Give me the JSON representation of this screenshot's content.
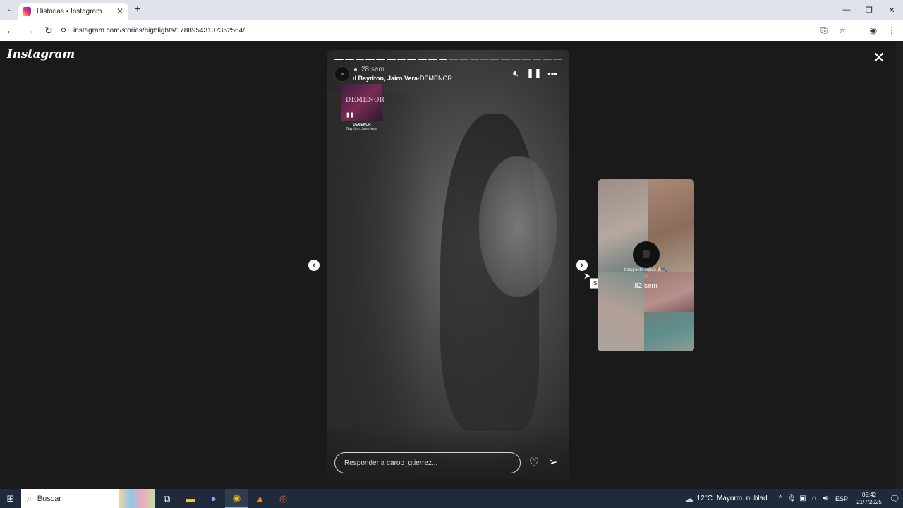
{
  "browser": {
    "tab_title": "Historias • Instagram",
    "tab_list_icon": "chevron-down-icon",
    "new_tab_label": "+",
    "url": "instagram.com/stories/highlights/17889543107352564/",
    "window_controls": [
      "—",
      "❐",
      "✕"
    ]
  },
  "page": {
    "logo_text": "Instagram",
    "close_glyph": "✕"
  },
  "story": {
    "progress_segments_total": 22,
    "progress_segments_done": 11,
    "time_ago": "28 sem",
    "music_artist": "Bayriton, Jairo Vera",
    "music_separator": " · ",
    "music_song": "DEMENOR",
    "sticker": {
      "art_text": "DEMENOR",
      "title": "DEMENOR",
      "artist": "Bayriton, Jairo Vera"
    },
    "reply_placeholder": "Responder a caroo_gtierrez..."
  },
  "navigation": {
    "prev_glyph": "‹",
    "next_glyph": "›",
    "tooltip": "Siguiente"
  },
  "next_preview": {
    "caption": "Integrante nuevo 🐶🐾",
    "time_ago": "82 sem"
  },
  "taskbar": {
    "search_label": "Buscar",
    "weather_temp": "12°C",
    "weather_desc": "Mayorm. nublado",
    "language": "ESP",
    "time": "05:42",
    "date": "21/7/2025"
  },
  "colors": {
    "page_bg": "#1a1a1a",
    "tabbar_bg": "#dfe3eb",
    "taskbar_bg": "#1f2b3a"
  }
}
